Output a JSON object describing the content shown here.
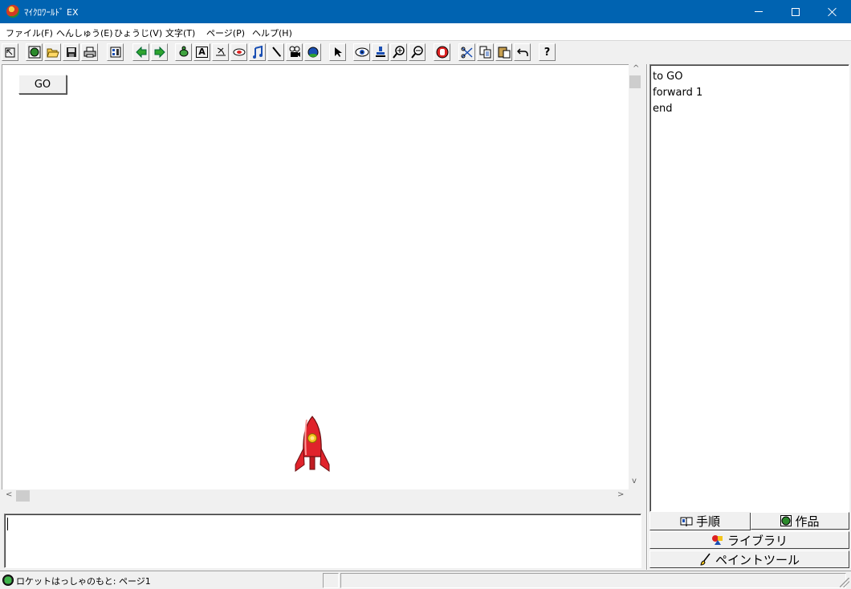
{
  "window": {
    "title": "ﾏｲｸﾛﾜｰﾙﾄﾞ EX"
  },
  "menu": [
    "ファイル(F)",
    "へんしゅう(E)",
    "ひょうじ(V)",
    "文字(T)",
    "ページ(P)",
    "ヘルプ(H)"
  ],
  "toolbar": {
    "items": [
      "arrow-tool",
      "new",
      "open",
      "save",
      "print",
      "pages",
      "prev-page",
      "next-page",
      "turtle",
      "text",
      "stamp",
      "button",
      "music",
      "pen",
      "video",
      "globe",
      "pointer",
      "eye",
      "stamp-tool",
      "zoom-in",
      "zoom-out",
      "stop",
      "cut",
      "copy",
      "paste",
      "undo",
      "help"
    ],
    "help_label": "?",
    "text_label": "A"
  },
  "canvas": {
    "go_button_label": "GO"
  },
  "procedures": {
    "lines": [
      "to GO",
      "forward 1",
      "end"
    ]
  },
  "tabs": {
    "procedures": "手順",
    "works": "作品",
    "library": "ライブラリ",
    "paint": "ペイントツール"
  },
  "status": {
    "text": "ロケットはっしゃのもと: ページ1"
  },
  "scroll_arrows": {
    "up": "^",
    "down": "v",
    "left": "<",
    "right": ">"
  }
}
